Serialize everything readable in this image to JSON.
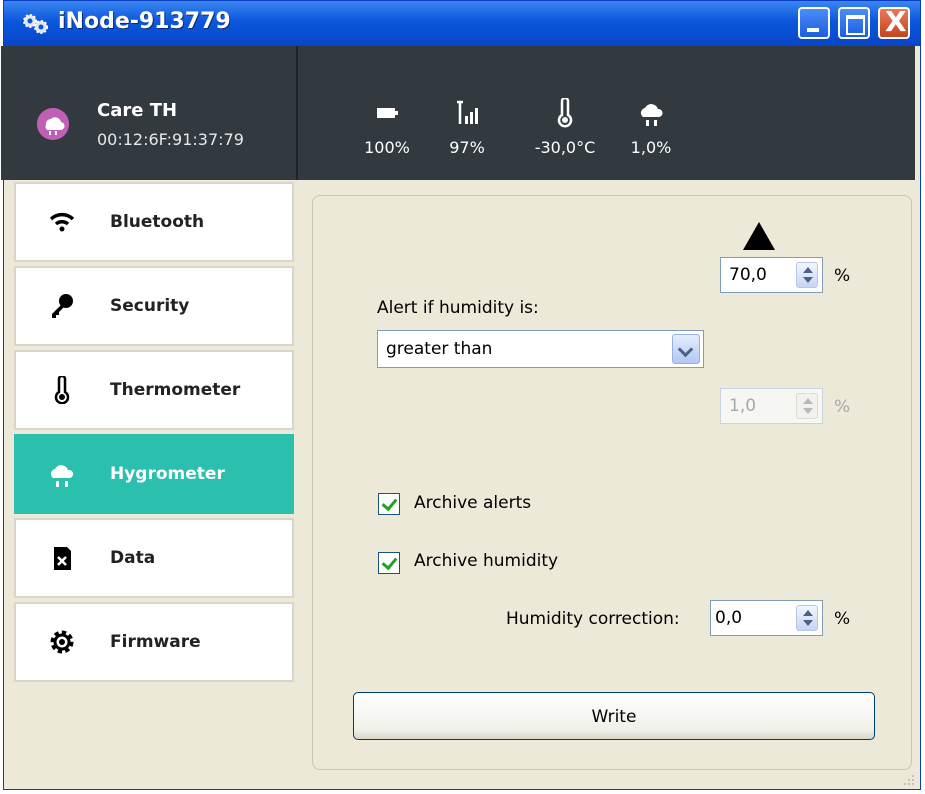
{
  "window": {
    "title": "iNode-913779",
    "controls": [
      "minimize",
      "maximize",
      "close"
    ],
    "close_glyph": "X"
  },
  "device": {
    "name": "Care TH",
    "mac": "00:12:6F:91:37:79",
    "icon": "cloud-rain-icon"
  },
  "stats": [
    {
      "icon": "battery-icon",
      "value": "100%"
    },
    {
      "icon": "signal-icon",
      "value": "97%"
    },
    {
      "icon": "thermometer-icon",
      "value": "-30,0°C"
    },
    {
      "icon": "cloud-rain-icon",
      "value": "1,0%"
    }
  ],
  "sidebar": {
    "items": [
      {
        "label": "Bluetooth",
        "icon": "wifi-icon",
        "active": false
      },
      {
        "label": "Security",
        "icon": "key-icon",
        "active": false
      },
      {
        "label": "Thermometer",
        "icon": "thermometer-icon",
        "active": false
      },
      {
        "label": "Hygrometer",
        "icon": "cloud-rain-icon",
        "active": true
      },
      {
        "label": "Data",
        "icon": "sd-card-icon",
        "active": false
      },
      {
        "label": "Firmware",
        "icon": "gear-icon",
        "active": false
      }
    ],
    "active_color": "#2bbfae"
  },
  "hygrometer": {
    "upper_value": "70,0",
    "upper_unit": "%",
    "alert_label": "Alert if humidity is:",
    "alert_condition": "greater than",
    "lower_value": "1,0",
    "lower_unit": "%",
    "archive_alerts_label": "Archive alerts",
    "archive_alerts_checked": true,
    "archive_humidity_label": "Archive humidity",
    "archive_humidity_checked": true,
    "correction_label": "Humidity correction:",
    "correction_value": "0,0",
    "correction_unit": "%",
    "write_label": "Write"
  }
}
